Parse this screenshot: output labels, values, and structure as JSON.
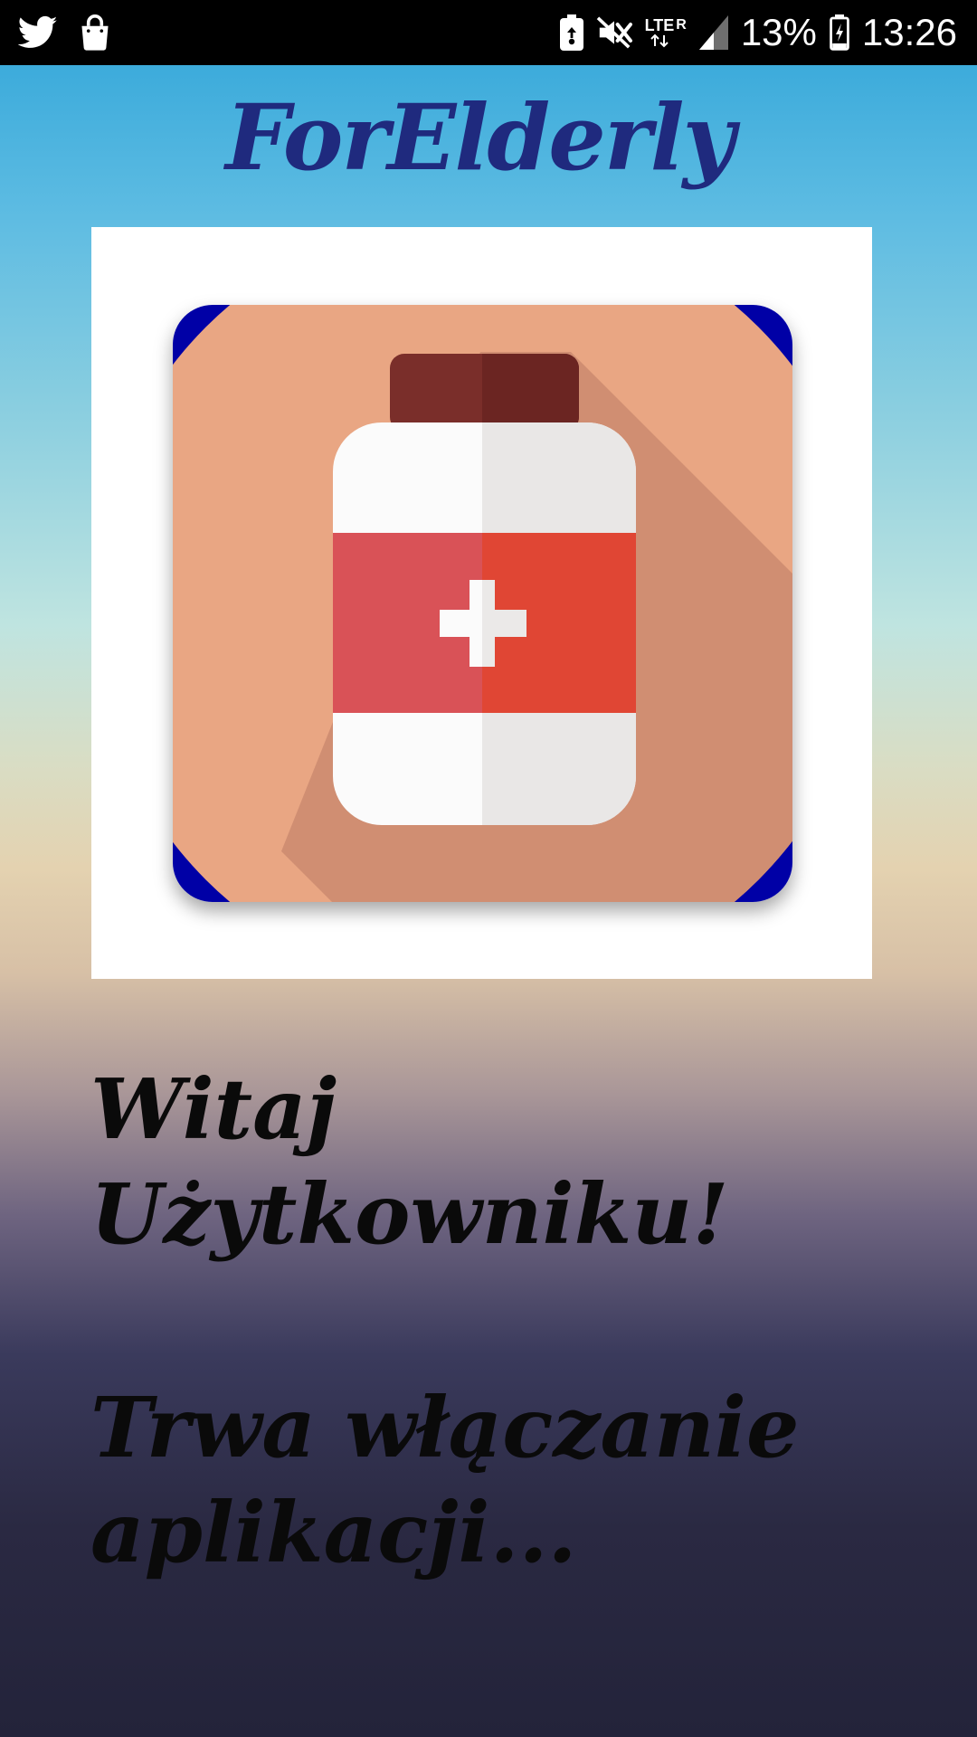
{
  "status_bar": {
    "left_icons": [
      "twitter-icon",
      "shopping-bag-icon"
    ],
    "right_icons": [
      "battery-saver-icon",
      "muted-icon",
      "lte-roaming-icon",
      "signal-icon",
      "battery-charging-icon"
    ],
    "lte_label": "LTE",
    "roaming_label": "R",
    "battery_percent": "13%",
    "time": "13:26"
  },
  "app": {
    "title": "ForElderly",
    "logo_icon": "medicine-bottle-icon",
    "welcome_line1": "Witaj",
    "welcome_line2": "Użytkowniku!",
    "loading_line1": "Trwa włączanie",
    "loading_line2": "aplikacji..."
  },
  "colors": {
    "title": "#1f2a7e",
    "logo_background": "#0202a6",
    "logo_circle": "#e9a683",
    "bottle_cap": "#7a2e2a",
    "bottle_label": "#d95257"
  }
}
